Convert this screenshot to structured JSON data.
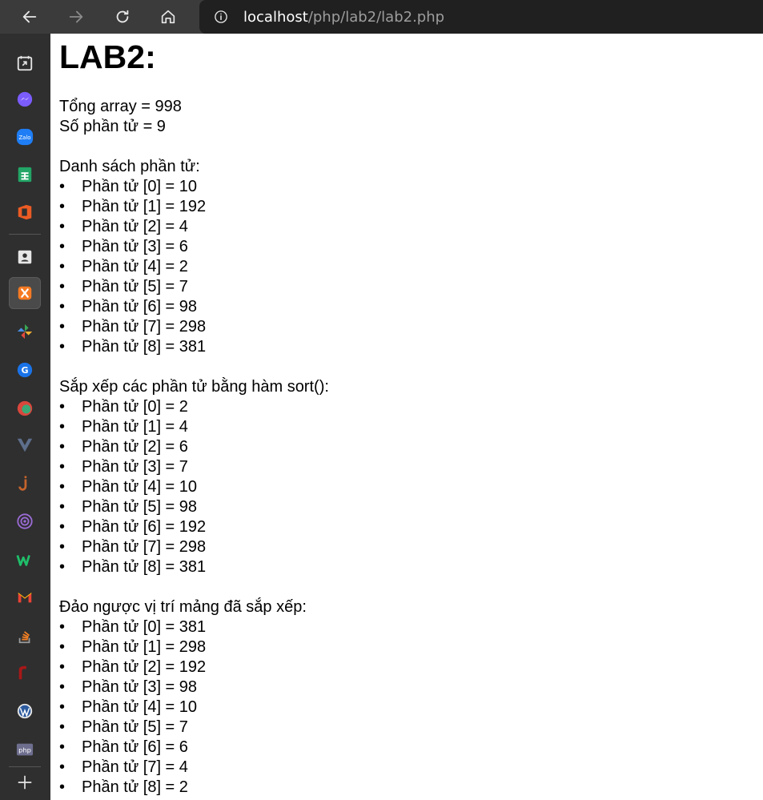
{
  "browser": {
    "url_host": "localhost",
    "url_path": "/php/lab2/lab2.php"
  },
  "sidebar": {
    "icons": [
      "collections-icon",
      "messenger-icon",
      "zalo-icon",
      "google-sheets-icon",
      "office-icon",
      "contacts-icon",
      "xampp-icon",
      "pinwheel-icon",
      "google-translate-icon",
      "app-s-icon",
      "vuejs-icon",
      "j-app-icon",
      "podcasts-icon",
      "webtoon-icon",
      "gmail-icon",
      "stackoverflow-icon",
      "redmine-icon",
      "wordpress-icon",
      "php-icon",
      "add-icon"
    ],
    "php_label": "php",
    "zalo_label": "Zalo"
  },
  "page": {
    "title": "LAB2:",
    "sum_line": "Tổng array = 998",
    "count_line": "Số phần tử = 9",
    "sections": [
      {
        "heading": "Danh sách phần tử:",
        "items": [
          "Phần tử [0] = 10",
          "Phần tử [1] = 192",
          "Phần tử [2] = 4",
          "Phần tử [3] = 6",
          "Phần tử [4] = 2",
          "Phần tử [5] = 7",
          "Phần tử [6] = 98",
          "Phần tử [7] = 298",
          "Phần tử [8] = 381"
        ]
      },
      {
        "heading": "Sắp xếp các phần tử bằng hàm sort():",
        "items": [
          "Phần tử [0] = 2",
          "Phần tử [1] = 4",
          "Phần tử [2] = 6",
          "Phần tử [3] = 7",
          "Phần tử [4] = 10",
          "Phần tử [5] = 98",
          "Phần tử [6] = 192",
          "Phần tử [7] = 298",
          "Phần tử [8] = 381"
        ]
      },
      {
        "heading": "Đảo ngược vị trí mảng đã sắp xếp:",
        "items": [
          "Phần tử [0] = 381",
          "Phần tử [1] = 298",
          "Phần tử [2] = 192",
          "Phần tử [3] = 98",
          "Phần tử [4] = 10",
          "Phần tử [5] = 7",
          "Phần tử [6] = 6",
          "Phần tử [7] = 4",
          "Phần tử [8] = 2"
        ]
      }
    ]
  }
}
